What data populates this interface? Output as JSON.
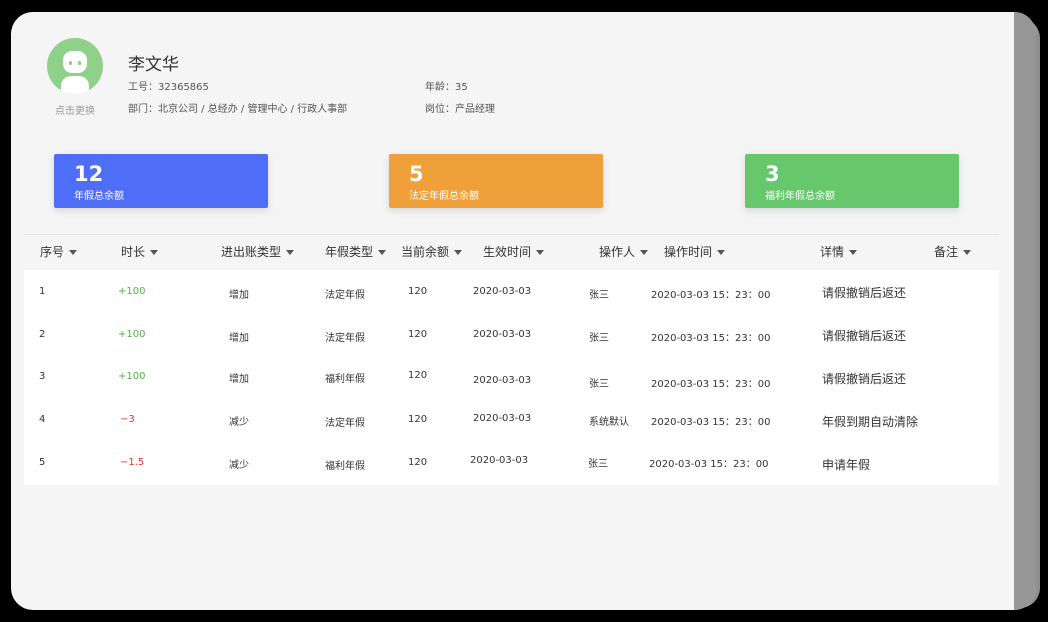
{
  "profile": {
    "name": "李文华",
    "change_avatar": "点击更换",
    "employee_id": "工号：32365865",
    "department": "部门：北京公司 / 总经办 / 管理中心 / 行政人事部",
    "age": "年龄：35",
    "position": "岗位：产品经理"
  },
  "stats": [
    {
      "value": "12",
      "label": "年假总余额",
      "color": "#4f6ef7"
    },
    {
      "value": "5",
      "label": "法定年假总余额",
      "color": "#f0a03b"
    },
    {
      "value": "3",
      "label": "福利年假总余额",
      "color": "#67c76d"
    }
  ],
  "table": {
    "columns": [
      "序号",
      "时长",
      "进出账类型",
      "年假类型",
      "当前余额",
      "生效时间",
      "操作人",
      "操作时间",
      "详情",
      "备注"
    ],
    "rows": [
      {
        "index": "1",
        "duration": "+100",
        "entry_type": "增加",
        "leave_type": "法定年假",
        "balance": "120",
        "effective": "2020-03-03",
        "operator": "张三",
        "op_time": "2020-03-03  15：23：00",
        "detail": "请假撤销后返还",
        "note": ""
      },
      {
        "index": "2",
        "duration": "+100",
        "entry_type": "增加",
        "leave_type": "法定年假",
        "balance": "120",
        "effective": "2020-03-03",
        "operator": "张三",
        "op_time": "2020-03-03  15：23：00",
        "detail": "请假撤销后返还",
        "note": ""
      },
      {
        "index": "3",
        "duration": "+100",
        "entry_type": "增加",
        "leave_type": "福利年假",
        "balance": "120",
        "effective": "2020-03-03",
        "operator": "张三",
        "op_time": "2020-03-03  15：23：00",
        "detail": "请假撤销后返还",
        "note": ""
      },
      {
        "index": "4",
        "duration": "−3",
        "entry_type": "减少",
        "leave_type": "法定年假",
        "balance": "120",
        "effective": "2020-03-03",
        "operator": "系统默认",
        "op_time": "2020-03-03  15：23：00",
        "detail": "年假到期自动清除",
        "note": ""
      },
      {
        "index": "5",
        "duration": "−1.5",
        "entry_type": "减少",
        "leave_type": "福利年假",
        "balance": "120",
        "effective": "2020-03-03",
        "operator": "张三",
        "op_time": "2020-03-03  15：23：00",
        "detail": "申请年假",
        "note": ""
      }
    ]
  }
}
